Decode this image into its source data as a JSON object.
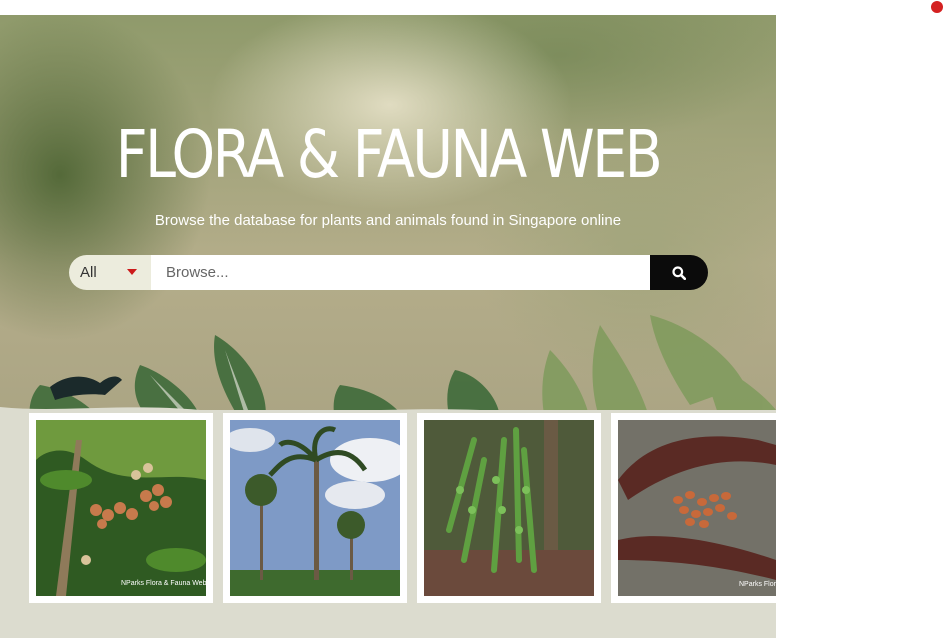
{
  "hero": {
    "title": "FLORA & FAUNA WEB",
    "subtitle": "Browse the database for plants and animals found in Singapore online"
  },
  "search": {
    "category_selected": "All",
    "placeholder": "Browse...",
    "value": "",
    "button_icon": "search-icon"
  },
  "gallery": {
    "items": [
      {
        "subject": "fruiting-shrub-photo",
        "watermark": "NParks Flora & Fauna Web"
      },
      {
        "subject": "palm-trees-photo",
        "watermark": ""
      },
      {
        "subject": "fern-photo",
        "watermark": ""
      },
      {
        "subject": "seed-pods-photo",
        "watermark": "NParks Flor"
      }
    ]
  },
  "colors": {
    "accent_red": "#cc1a1a",
    "search_button": "#0b0b0b",
    "band": "#dcdccf"
  }
}
